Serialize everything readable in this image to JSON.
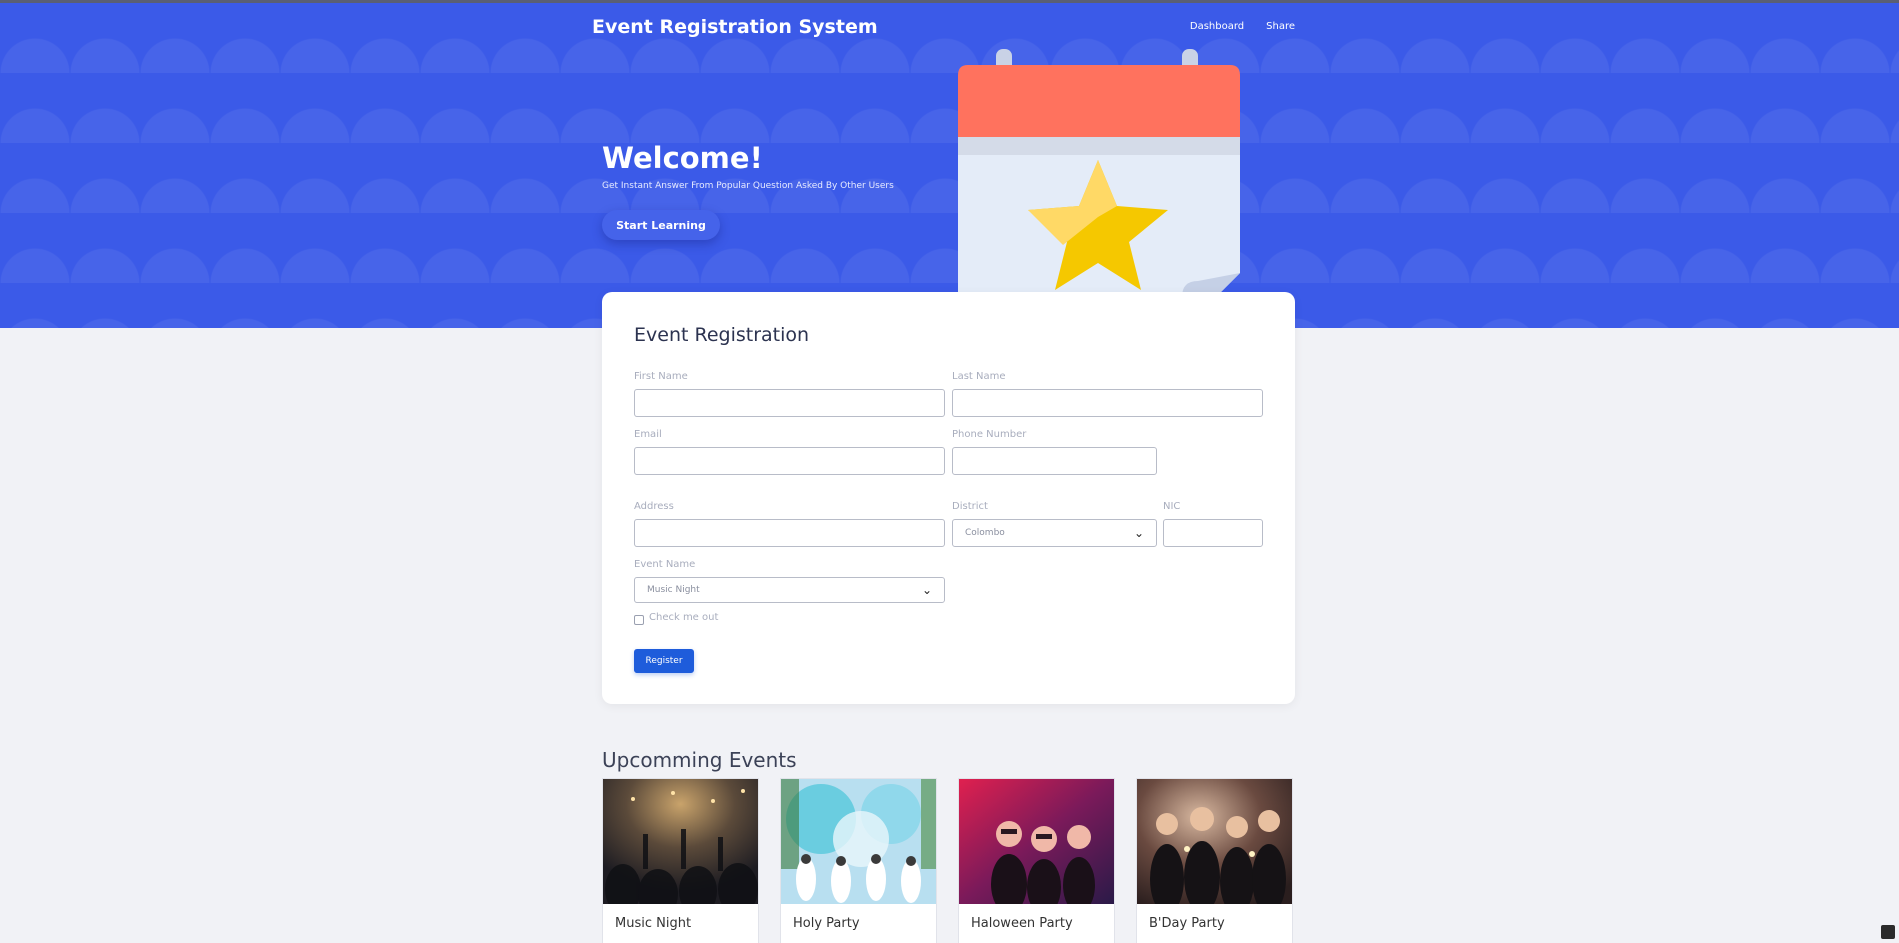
{
  "header": {
    "brand": "Event Registration System",
    "nav": [
      {
        "label": "Dashboard"
      },
      {
        "label": "Share"
      }
    ]
  },
  "hero": {
    "title": "Welcome!",
    "subtitle": "Get Instant Answer From Popular Question Asked By Other Users",
    "cta_label": "Start Learning",
    "illustration": "calendar-star-icon"
  },
  "form": {
    "title": "Event Registration",
    "first_name": {
      "label": "First Name",
      "value": ""
    },
    "last_name": {
      "label": "Last Name",
      "value": ""
    },
    "email": {
      "label": "Email",
      "value": ""
    },
    "phone": {
      "label": "Phone Number",
      "value": ""
    },
    "address": {
      "label": "Address",
      "value": ""
    },
    "district": {
      "label": "District",
      "selected": "Colombo"
    },
    "nic": {
      "label": "NIC",
      "value": ""
    },
    "event_name": {
      "label": "Event Name",
      "selected": "Music Night"
    },
    "checkbox_label": "Check me out",
    "submit_label": "Register"
  },
  "events": {
    "title": "Upcomming Events",
    "items": [
      {
        "name": "Music Night",
        "image": "concert-crowd-photo"
      },
      {
        "name": "Holy Party",
        "image": "color-festival-photo"
      },
      {
        "name": "Haloween Party",
        "image": "masquerade-party-photo"
      },
      {
        "name": "B'Day Party",
        "image": "birthday-party-photo"
      }
    ]
  },
  "colors": {
    "hero_bg": "#3b5ae8",
    "primary_button": "#1e5cdb",
    "page_bg": "#f1f2f6",
    "calendar_header": "#ff725e",
    "star": "#f5c800"
  }
}
